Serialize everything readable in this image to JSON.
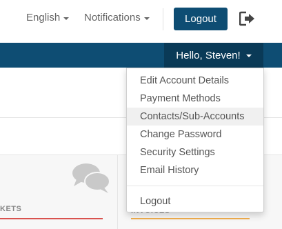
{
  "topbar": {
    "language_label": "English",
    "notifications_label": "Notifications",
    "logout_label": "Logout"
  },
  "navbar": {
    "greeting": "Hello, Steven!"
  },
  "dropdown": {
    "items": [
      {
        "label": "Edit Account Details"
      },
      {
        "label": "Payment Methods"
      },
      {
        "label": "Contacts/Sub-Accounts",
        "highlighted": true
      },
      {
        "label": "Change Password"
      },
      {
        "label": "Security Settings"
      },
      {
        "label": "Email History"
      }
    ],
    "logout_label": "Logout"
  },
  "panels": {
    "left_label": "KETS",
    "right_label": "INVOICES"
  },
  "colors": {
    "brand": "#0e4d73",
    "brand_dark": "#0a3a57",
    "accent_red": "#d9534f",
    "accent_orange": "#f0ad4e"
  },
  "icons": {
    "exit": "sign-out-icon",
    "chat": "comments-icon"
  }
}
